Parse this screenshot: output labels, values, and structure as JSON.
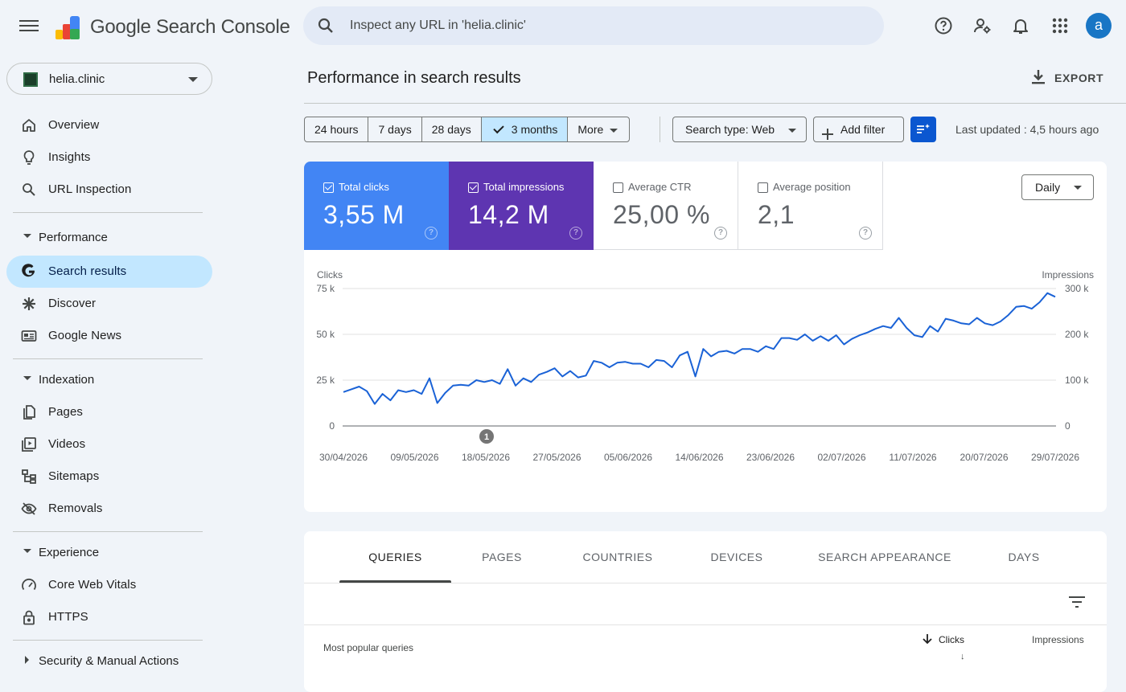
{
  "app": {
    "title": "Google Search Console"
  },
  "search": {
    "placeholder": "Inspect any URL in 'helia.clinic'"
  },
  "user": {
    "avatar_letter": "a"
  },
  "property": {
    "name": "helia.clinic"
  },
  "sidebar": {
    "top_items": [
      {
        "label": "Overview",
        "icon": "home-icon"
      },
      {
        "label": "Insights",
        "icon": "lightbulb-icon"
      },
      {
        "label": "URL Inspection",
        "icon": "search-icon"
      }
    ],
    "performance": {
      "label": "Performance",
      "items": [
        {
          "label": "Search results",
          "icon": "google-g-icon",
          "selected": true
        },
        {
          "label": "Discover",
          "icon": "asterisk-icon"
        },
        {
          "label": "Google News",
          "icon": "news-icon"
        }
      ]
    },
    "indexation": {
      "label": "Indexation",
      "items": [
        {
          "label": "Pages",
          "icon": "pages-icon"
        },
        {
          "label": "Videos",
          "icon": "video-icon"
        },
        {
          "label": "Sitemaps",
          "icon": "sitemap-icon"
        },
        {
          "label": "Removals",
          "icon": "eye-off-icon"
        }
      ]
    },
    "experience": {
      "label": "Experience",
      "items": [
        {
          "label": "Core Web Vitals",
          "icon": "speedometer-icon"
        },
        {
          "label": "HTTPS",
          "icon": "lock-icon"
        }
      ]
    },
    "security": {
      "label": "Security & Manual Actions"
    }
  },
  "main": {
    "title": "Performance in search results",
    "export_label": "EXPORT",
    "date_ranges": [
      "24 hours",
      "7 days",
      "28 days",
      "3 months",
      "More"
    ],
    "selected_range": "3 months",
    "search_type": "Search type: Web",
    "add_filter": "Add filter",
    "last_updated": "Last updated : 4,5 hours ago"
  },
  "metrics": [
    {
      "label": "Total clicks",
      "value": "3,55 M",
      "checked": true,
      "color": "#4285f4"
    },
    {
      "label": "Total impressions",
      "value": "14,2 M",
      "checked": true,
      "color": "#5e35b1"
    },
    {
      "label": "Average CTR",
      "value": "25,00 %",
      "checked": false
    },
    {
      "label": "Average position",
      "value": "2,1",
      "checked": false
    }
  ],
  "granularity": "Daily",
  "chart_data": {
    "type": "line",
    "left_axis_label": "Clicks",
    "right_axis_label": "Impressions",
    "left_ticks": [
      "0",
      "25 k",
      "50 k",
      "75 k"
    ],
    "right_ticks": [
      "0",
      "100 k",
      "200 k",
      "300 k"
    ],
    "ylim": [
      0,
      75000
    ],
    "x_tick_labels": [
      "30/04/2026",
      "09/05/2026",
      "18/05/2026",
      "27/05/2026",
      "05/06/2026",
      "14/06/2026",
      "23/06/2026",
      "02/07/2026",
      "11/07/2026",
      "20/07/2026",
      "29/07/2026"
    ],
    "x_range": [
      "30/04/2026",
      "29/07/2026"
    ],
    "annotation": {
      "label": "1",
      "date": "18/05/2026"
    },
    "series": [
      {
        "name": "Clicks",
        "color": "#1a62d6",
        "values": [
          18500,
          20000,
          21500,
          19000,
          12000,
          17500,
          14000,
          19500,
          18500,
          19500,
          17500,
          26000,
          12500,
          18000,
          22000,
          22500,
          22000,
          25000,
          24000,
          25000,
          23000,
          31000,
          22000,
          26000,
          24000,
          28000,
          29500,
          31500,
          27000,
          30000,
          26500,
          27500,
          35500,
          34500,
          32000,
          34500,
          35000,
          34000,
          34000,
          32000,
          36000,
          35500,
          32000,
          38500,
          40500,
          27000,
          42000,
          38000,
          40500,
          41000,
          39500,
          42000,
          42000,
          40500,
          43500,
          42000,
          48000,
          48000,
          47000,
          50000,
          46500,
          49000,
          46500,
          49500,
          44500,
          47500,
          49500,
          51000,
          53000,
          54500,
          53500,
          59000,
          53500,
          49500,
          48500,
          54500,
          51500,
          58500,
          57500,
          56000,
          55500,
          59000,
          56000,
          55000,
          57000,
          60500,
          65000,
          65500,
          64000,
          67500,
          72500,
          70500
        ]
      }
    ]
  },
  "table": {
    "tabs": [
      "QUERIES",
      "PAGES",
      "COUNTRIES",
      "DEVICES",
      "SEARCH APPEARANCE",
      "DAYS"
    ],
    "active_tab": "QUERIES",
    "first_col_header": "Most popular queries",
    "clicks_header": "Clicks",
    "impressions_header": "Impressions",
    "sort_marker": "↓"
  }
}
